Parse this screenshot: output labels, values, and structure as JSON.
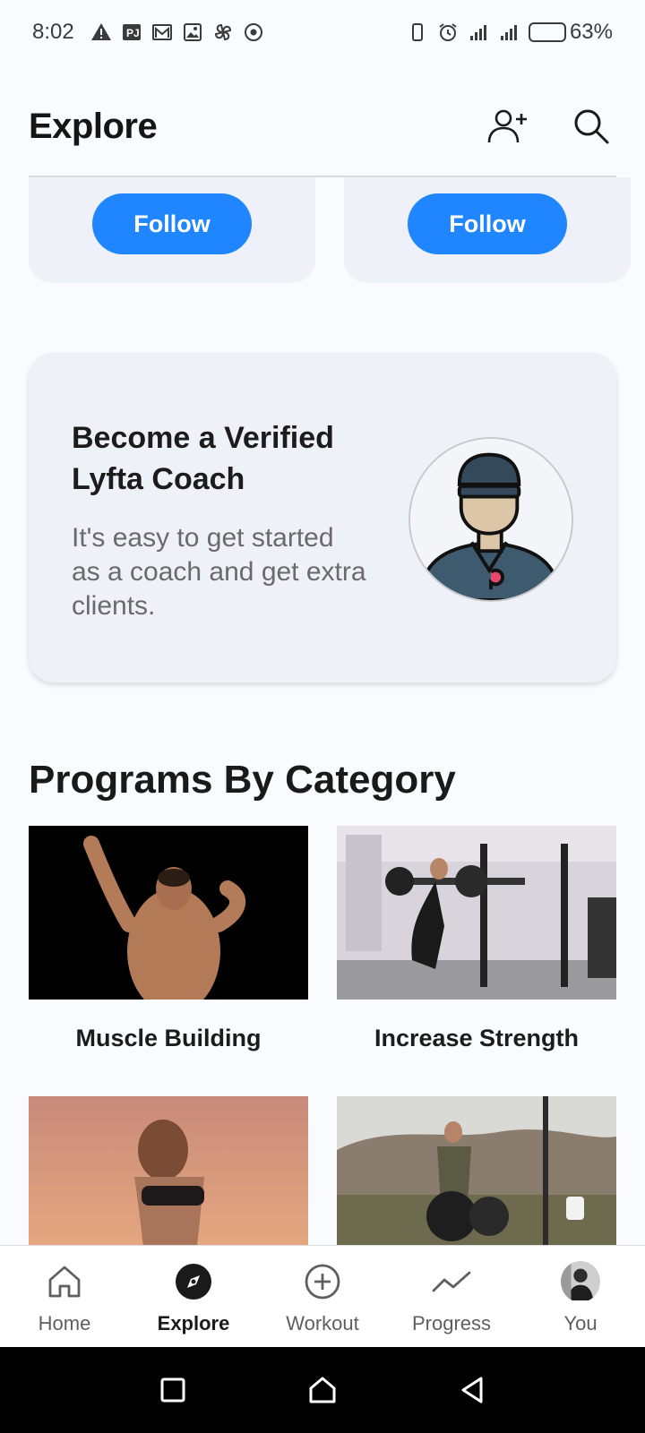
{
  "status_bar": {
    "time": "8:02",
    "battery": "63%",
    "battery_level": 0.63
  },
  "header": {
    "title": "Explore"
  },
  "suggested_follows": [
    {
      "button_label": "Follow"
    },
    {
      "button_label": "Follow"
    }
  ],
  "coach_promo": {
    "title": "Become a Verified Lyfta Coach",
    "description": "It's easy to get started as a coach and get extra clients."
  },
  "programs": {
    "section_title": "Programs By Category",
    "items": [
      {
        "label": "Muscle Building"
      },
      {
        "label": "Increase Strength"
      },
      {
        "label": ""
      },
      {
        "label": ""
      }
    ]
  },
  "bottom_nav": {
    "items": [
      {
        "label": "Home",
        "icon": "home-icon"
      },
      {
        "label": "Explore",
        "icon": "compass-icon",
        "active": true
      },
      {
        "label": "Workout",
        "icon": "plus-circle-icon"
      },
      {
        "label": "Progress",
        "icon": "trend-line-icon"
      },
      {
        "label": "You",
        "icon": "avatar"
      }
    ]
  },
  "colors": {
    "accent": "#1f86ff",
    "card_bg": "#eef1f8",
    "page_bg": "#fafbff"
  }
}
